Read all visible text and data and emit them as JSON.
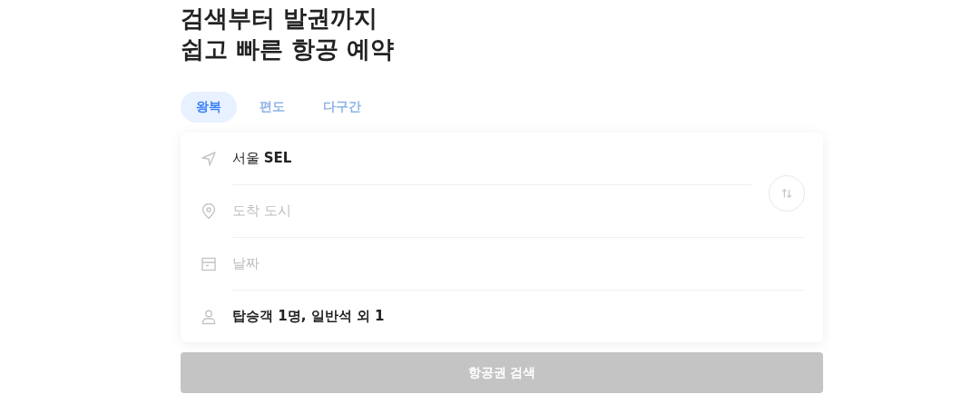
{
  "heading": [
    "검색부터 발권까지",
    "쉽고 빠른 항공 예약"
  ],
  "tabs": [
    {
      "label": "왕복",
      "selected": true
    },
    {
      "label": "편도",
      "selected": false
    },
    {
      "label": "다구간",
      "selected": false
    }
  ],
  "fields": [
    {
      "kind": "departure",
      "value": "서울 **SEL**"
    },
    {
      "kind": "arrival",
      "placeholder": "도착 도시"
    },
    {
      "kind": "date",
      "placeholder": "날짜"
    },
    {
      "kind": "passengers",
      "value": "탑승객 1명, 일반석 외 1"
    }
  ],
  "search_button": {
    "label": "항공권 검색",
    "disabled": true
  }
}
